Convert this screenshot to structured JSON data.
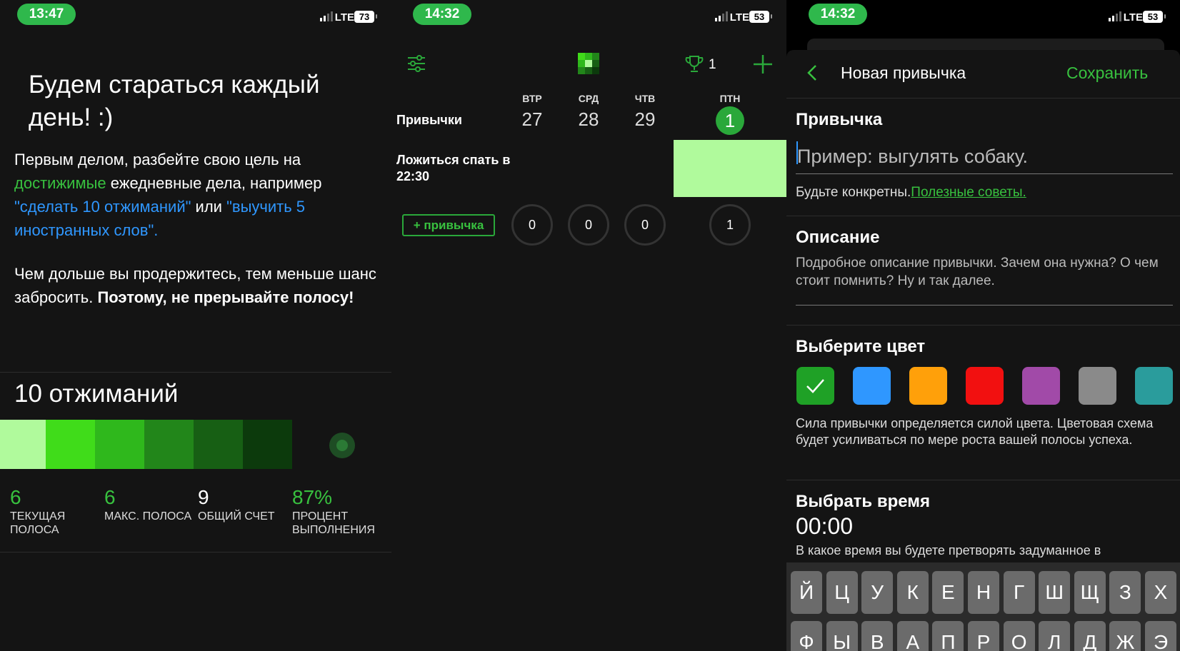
{
  "status": [
    {
      "time": "13:47",
      "network": "LTE",
      "battery": "73"
    },
    {
      "time": "14:32",
      "network": "LTE",
      "battery": "53"
    },
    {
      "time": "14:32",
      "network": "LTE",
      "battery": "53"
    }
  ],
  "onboarding": {
    "heading": "Будем стараться каждый день! :)",
    "p1_a": "Первым делом, разбейте свою цель на ",
    "p1_link": "достижимые",
    "p1_b": " ежедневные дела, например ",
    "p1_ex1": "\"сделать 10 отжиманий\"",
    "p1_or": " или ",
    "p1_ex2": "\"выучить 5 иностранных слов\".",
    "p2_a": "Чем дольше вы продержитесь, тем меньше шанс забросить. ",
    "p2_bold": "Поэтому, не прерывайте полосу!",
    "habit_name": "10 отжиманий",
    "strip_colors": [
      "#b0fa9c",
      "#40dc1a",
      "#2fb81c",
      "#22861a",
      "#175f14",
      "#0c3a0c"
    ],
    "stats": [
      {
        "value": "6",
        "label": "Текущая полоса",
        "color": "#38c13f"
      },
      {
        "value": "6",
        "label": "Макс. полоса",
        "color": "#38c13f"
      },
      {
        "value": "9",
        "label": "Общий счет",
        "color": "#ffffff"
      },
      {
        "value": "87%",
        "label": "Процент выполнения",
        "color": "#38c13f"
      }
    ]
  },
  "tracker": {
    "trophy_count": "1",
    "habits_header": "Привычки",
    "days": [
      {
        "name": "ВТР",
        "date": "27"
      },
      {
        "name": "СРД",
        "date": "28"
      },
      {
        "name": "ЧТВ",
        "date": "29"
      },
      {
        "name": "ПТН",
        "date": "1"
      }
    ],
    "habit": "Ложиться спать в 22:30",
    "add_button": "+ привычка",
    "counts": [
      "0",
      "0",
      "0",
      "1"
    ]
  },
  "new_habit": {
    "title": "Новая привычка",
    "save": "Сохранить",
    "habit_section": "Привычка",
    "habit_placeholder": "Пример: выгулять собаку.",
    "hint": "Будьте конкретны.",
    "hint_link": "Полезные советы.",
    "desc_section": "Описание",
    "desc_placeholder": "Подробное описание привычки. Зачем она нужна? О чем стоит помнить? Ну и так далее.",
    "color_section": "Выберите цвет",
    "colors": [
      "#1fa126",
      "#2f97ff",
      "#ffa00a",
      "#f21010",
      "#a14aa8",
      "#8a8a8a",
      "#2a9c9c"
    ],
    "color_note": "Сила привычки определяется силой цвета. Цветовая схема будет усиливаться по мере роста вашей полосы успеха.",
    "time_section": "Выбрать время",
    "time_value": "00:00",
    "time_note": "В какое время вы будете претворять задуманное в",
    "keyboard_row1": [
      "Й",
      "Ц",
      "У",
      "К",
      "Е",
      "Н",
      "Г",
      "Ш",
      "Щ",
      "З",
      "Х"
    ],
    "keyboard_row2": [
      "Ф",
      "Ы",
      "В",
      "А",
      "П",
      "Р",
      "О",
      "Л",
      "Д",
      "Ж",
      "Э"
    ]
  }
}
